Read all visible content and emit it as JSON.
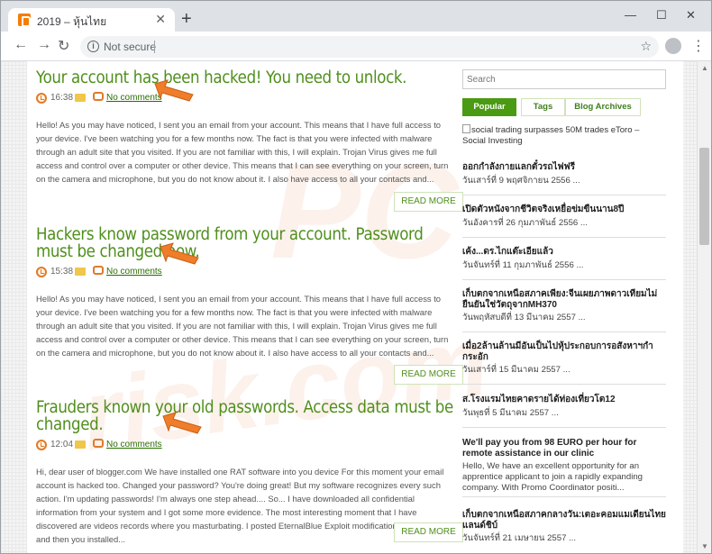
{
  "browser": {
    "tab_title": "2019 – หุ้นไทย",
    "tab_close": "✕",
    "new_tab": "+",
    "window_min": "—",
    "window_max": "☐",
    "window_close": "✕",
    "back": "←",
    "forward": "→",
    "reload": "↻",
    "info_icon": "i",
    "security_label": "Not secure",
    "bookmark_star": "☆",
    "menu": "⋮"
  },
  "watermark": {
    "text1": "PC",
    "text2": "risk.com"
  },
  "posts": [
    {
      "title": "Your account has been hacked! You need to unlock.",
      "time": "16:38",
      "comments": "No comments",
      "excerpt": "Hello! As you may have noticed, I sent you an email from your account. This means that I have full access to your device. I've been watching you for a few months now. The fact is that you were infected with malware through an adult site that you visited. If you are not familiar with this, I will explain. Trojan Virus gives me full access and control over a computer or other device. This means that I can see everything on your screen, turn on the camera and microphone, but you do not know about it. I also have access to all your contacts and...",
      "more": "READ MORE"
    },
    {
      "title": "Hackers know password from your account. Password must be changed now.",
      "time": "15:38",
      "comments": "No comments",
      "excerpt": "Hello! As you may have noticed, I sent you an email from your account. This means that I have full access to your device. I've been watching you for a few months now. The fact is that you were infected with malware through an adult site that you visited. If you are not familiar with this, I will explain. Trojan Virus gives me full access and control over a computer or other device. This means that I can see everything on your screen, turn on the camera and microphone, but you do not know about it. I also have access to all your contacts and...",
      "more": "READ MORE"
    },
    {
      "title": "Frauders known your old passwords. Access data must be changed.",
      "time": "12:04",
      "comments": "No comments",
      "excerpt": "Hi, dear user of blogger.com We have installed one RAT software into you device For this moment your email account is hacked too. Changed your password? You're doing great! But my software recognizes every such action. I'm updating passwords! I'm always one step ahead.... So... I have downloaded all confidential information from your system and I got some more evidence. The most interesting moment that I have discovered are videos records where you masturbating. I posted EternalBlue Exploit modification on porn site, and then you installed...",
      "more": "READ MORE"
    }
  ],
  "sidebar": {
    "search_placeholder": "Search",
    "tabs": [
      "Popular",
      "Tags",
      "Blog Archives"
    ],
    "ad_image_alt": "social trading surpasses 50M trades eToro – Social Investing",
    "items": [
      {
        "title": "ออกกำลังกายแลกตั๋วรถไฟฟรี",
        "date": "วันเสาร์ที่ 9 พฤศจิกายน 2556 ..."
      },
      {
        "title": "เปิดตัวหนังจากชีวิตจริงเหยื่อข่มขืนนาน8ปี",
        "date": "วันอังคารที่ 26 กุมภาพันธ์ 2556 ..."
      },
      {
        "title": "เค้ง...ดร.ไกแต๊ะเอียแล้ว",
        "date": "วันจันทร์ที่ 11 กุมภาพันธ์ 2556 ..."
      },
      {
        "title": "เก็บตกจากเหนือสภาคเพียง:จีนเผยภาพดาวเทียมไม่ยืนยันใช่วัตถุจากMH370",
        "date": "วันพฤหัสบดีที่ 13 มีนาคม 2557 ..."
      },
      {
        "title": "เมื่อ2ล้านล้านมีอันเป็นไปหุ้ประกอบการอสังหาฯกำกระอัก",
        "date": "วันเสาร์ที่ 15 มีนาคม 2557 ..."
      },
      {
        "title": "ส.โรงแรมไทยคาดรายได้ท่องเที่ยวโต12",
        "date": "วันพุธที่ 5 มีนาคม 2557 ..."
      },
      {
        "title": "We'll pay you from 98 EURO per hour for remote assistance in our clinic",
        "date": "Hello, We have an excellent opportunity for an apprentice applicant to join a rapidly expanding company. With Promo Coordinator positi..."
      },
      {
        "title": "เก็บตกจากเหนือสภาคกลางวัน:เตอะคอมแมเดียนไทยแลนด์ชิบ์",
        "date": "วันจันทร์ที่ 21 เมษายน 2557 ..."
      }
    ]
  },
  "colors": {
    "accent": "#4f8f1c",
    "active_tab": "#4b9a13",
    "arrow": "#ef7d2a"
  }
}
